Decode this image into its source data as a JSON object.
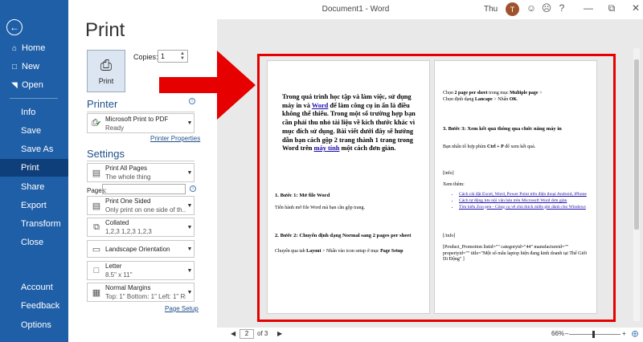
{
  "titlebar": {
    "document_title": "Document1  -  Word",
    "user_name": "Thu",
    "avatar_initial": "T",
    "icons": [
      "smiley-icon",
      "frown-icon",
      "help-icon",
      "minimize-icon",
      "restore-icon",
      "close-icon"
    ]
  },
  "nav": {
    "back_icon": "back-arrow-icon",
    "items": [
      {
        "label": "Home",
        "icon": "home-icon"
      },
      {
        "label": "New",
        "icon": "new-document-icon"
      },
      {
        "label": "Open",
        "icon": "open-folder-icon"
      },
      {
        "label": "Info"
      },
      {
        "label": "Save"
      },
      {
        "label": "Save As"
      },
      {
        "label": "Print",
        "active": true
      },
      {
        "label": "Share"
      },
      {
        "label": "Export"
      },
      {
        "label": "Transform"
      },
      {
        "label": "Close"
      },
      {
        "label": "Account"
      },
      {
        "label": "Feedback"
      },
      {
        "label": "Options"
      }
    ]
  },
  "print": {
    "title": "Print",
    "button_label": "Print",
    "copies_label": "Copies:",
    "copies_value": "1",
    "printer_heading": "Printer",
    "printer_name": "Microsoft Print to PDF",
    "printer_status": "Ready",
    "printer_properties_link": "Printer Properties",
    "settings_heading": "Settings",
    "pages_label": "Pages:",
    "page_setup_link": "Page Setup",
    "settings": [
      {
        "main": "Print All Pages",
        "sub": "The whole thing"
      },
      {
        "main": "Print One Sided",
        "sub": "Only print on one side of th..."
      },
      {
        "main": "Collated",
        "sub": "1,2,3    1,2,3    1,2,3"
      },
      {
        "main": "Landscape Orientation",
        "sub": ""
      },
      {
        "main": "Letter",
        "sub": "8.5\" x 11\""
      },
      {
        "main": "Normal Margins",
        "sub": "Top: 1\" Bottom: 1\" Left: 1\" Ri..."
      }
    ]
  },
  "preview": {
    "page1": {
      "intro_before_word": "Trong quá trình học tập và làm việc, sử dụng máy in và ",
      "intro_word_link": "Word",
      "intro_middle": " để làm công cụ in ấn là điều không thể thiếu. Trong một số trường hợp bạn cần phải thu nhỏ tài liệu về kích thước khác vì mục đích sử dụng. Bài viết dưới đây sẽ hướng dẫn bạn cách gộp 2 trang thành 1 trang trong Word trên ",
      "intro_pc_link": "máy tính",
      "intro_end": " một cách đơn giản.",
      "step1_heading": "1. Bước 1: Mở file Word",
      "step1_text": "Tiến hành mở file Word mà bạn cần gộp trang.",
      "step2_heading": "2. Bước 2: Chuyển định dạng Normal sang 2 pages per sheet",
      "step2_text_a": "Chuyển qua tab ",
      "step2_text_b": "Layout",
      "step2_text_c": " > Nhấn vào icon setup ở mục ",
      "step2_text_d": "Page Setup"
    },
    "page2": {
      "line1_a": "Chọn ",
      "line1_b": "2 page per sheet",
      "line1_c": " trong mục ",
      "line1_d": "Multiple page",
      "line1_e": " >",
      "line2_a": "Chọn định dạng ",
      "line2_b": "Lancape",
      "line2_c": " > Nhấn ",
      "line2_d": "OK",
      "line2_e": ".",
      "step3_heading": "3. Bước 3: Xem kết quả thông qua chức năng máy in",
      "step3_text_a": "Bạn nhấn tổ hợp phím ",
      "step3_text_b": "Ctrl + P",
      "step3_text_c": " để xem kết quả.",
      "info_open": "[info]",
      "see_more": "Xem thêm:",
      "links": [
        "Cách cài đặt Excel, Word, Power Point trên điện thoại Android, iPhone",
        "Cách tự động lưu nội văn bản trên Microsoft Word đơn giản",
        "Tìm hiểu Zoo pen - Công cụ vẽ chú thích miễn phí dành cho Windows"
      ],
      "info_close": "[/info]",
      "product_promo": "[Product_Promotion listid=\"\" categoryid=\"44\" manufactureid=\"\" propertyid=\"\" title=\"Một số mẫu laptop hiện đang kinh doanh tại Thế Giới Di Động\" ]"
    }
  },
  "pager": {
    "current_page": "2",
    "total": "of 3",
    "zoom": "66%"
  },
  "colors": {
    "nav_bg": "#1f5fa8",
    "nav_active": "#0f3f7a",
    "annotation_red": "#e60000",
    "accent": "#1f4f8a"
  }
}
